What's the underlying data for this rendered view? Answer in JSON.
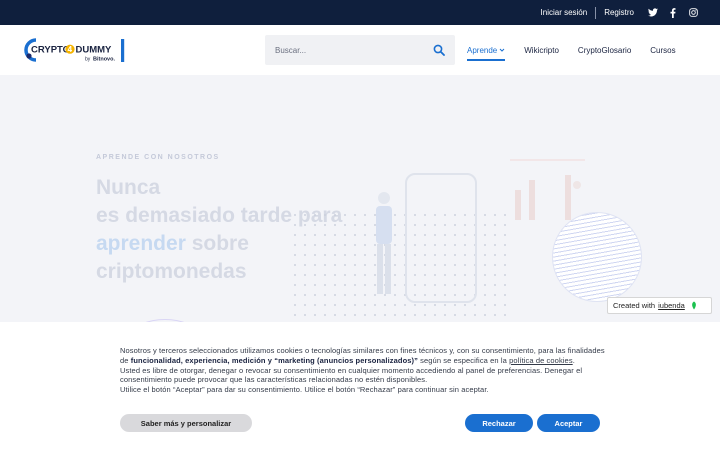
{
  "topbar": {
    "login": "Iniciar sesión",
    "register": "Registro",
    "social": [
      "twitter-icon",
      "facebook-icon",
      "instagram-icon"
    ]
  },
  "header": {
    "logo": {
      "brand_left": "CRYPTO",
      "brand_mid": "4",
      "brand_right": "DUMMY",
      "by": "by",
      "by_brand": "Bitnovo."
    },
    "search": {
      "placeholder": "Buscar..."
    },
    "nav": [
      {
        "label": "Aprende",
        "active": true,
        "has_dropdown": true
      },
      {
        "label": "Wikicripto",
        "active": false
      },
      {
        "label": "CryptoGlosario",
        "active": false
      },
      {
        "label": "Cursos",
        "active": false
      }
    ]
  },
  "hero": {
    "eyebrow": "APRENDE CON NOSOTROS",
    "title_line1": "Nunca",
    "title_line2": "es demasiado tarde para",
    "title_highlight": "aprender",
    "title_line3_rest": " sobre",
    "title_line4": "criptomonedas"
  },
  "iubenda": {
    "prefix": "Created with",
    "link": "iubenda"
  },
  "cookie": {
    "p1_a": "Nosotros y terceros seleccionados utilizamos cookies o tecnologías similares con fines técnicos y, con su consentimiento, para las finalidades de ",
    "p1_b": "funcionalidad, experiencia, medición y “marketing (anuncios personalizados)”",
    "p1_c": " según se especifica en la ",
    "p1_link": "política de cookies",
    "p1_end": ".",
    "p2": "Usted es libre de otorgar, denegar o revocar su consentimiento en cualquier momento accediendo al panel de preferencias. Denegar el consentimiento puede provocar que las características relacionadas no estén disponibles.",
    "p3": "Utilice el botón “Aceptar” para dar su consentimiento. Utilice el botón “Rechazar” para continuar sin aceptar.",
    "btn_customize": "Saber más y personalizar",
    "btn_reject": "Rechazar",
    "btn_accept": "Aceptar"
  },
  "colors": {
    "topbar": "#0f1f3d",
    "accent": "#1a6fd0",
    "logo_yellow": "#f5b400"
  }
}
